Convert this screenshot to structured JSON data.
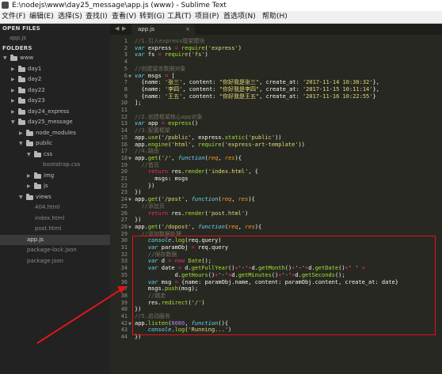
{
  "window": {
    "title": "E:\\nodejs\\www\\day25_message\\app.js (www) - Sublime Text"
  },
  "menu": [
    "文件(F)",
    "编辑(E)",
    "选择(S)",
    "查找(I)",
    "查看(V)",
    "转到(G)",
    "工具(T)",
    "项目(P)",
    "首选项(N)",
    "帮助(H)"
  ],
  "sidebar": {
    "open_files_header": "OPEN FILES",
    "open_files": [
      "app.js"
    ],
    "folders_header": "FOLDERS",
    "tree": [
      {
        "label": "www",
        "type": "folder",
        "depth": 0,
        "expanded": true
      },
      {
        "label": "day1",
        "type": "folder",
        "depth": 1,
        "expanded": false
      },
      {
        "label": "day2",
        "type": "folder",
        "depth": 1,
        "expanded": false
      },
      {
        "label": "day22",
        "type": "folder",
        "depth": 1,
        "expanded": false
      },
      {
        "label": "day23",
        "type": "folder",
        "depth": 1,
        "expanded": false
      },
      {
        "label": "day24_express",
        "type": "folder",
        "depth": 1,
        "expanded": false
      },
      {
        "label": "day25_message",
        "type": "folder",
        "depth": 1,
        "expanded": true
      },
      {
        "label": "node_modules",
        "type": "folder",
        "depth": 2,
        "expanded": false
      },
      {
        "label": "public",
        "type": "folder",
        "depth": 2,
        "expanded": true
      },
      {
        "label": "css",
        "type": "folder",
        "depth": 3,
        "expanded": true
      },
      {
        "label": "bootstrap.css",
        "type": "file",
        "depth": 4
      },
      {
        "label": "img",
        "type": "folder",
        "depth": 3,
        "expanded": false
      },
      {
        "label": "js",
        "type": "folder",
        "depth": 3,
        "expanded": false
      },
      {
        "label": "views",
        "type": "folder",
        "depth": 2,
        "expanded": true
      },
      {
        "label": "404.html",
        "type": "file",
        "depth": 3
      },
      {
        "label": "index.html",
        "type": "file",
        "depth": 3
      },
      {
        "label": "post.html",
        "type": "file",
        "depth": 3
      },
      {
        "label": "app.js",
        "type": "file",
        "depth": 2,
        "selected": true
      },
      {
        "label": "package-lock.json",
        "type": "file",
        "depth": 2
      },
      {
        "label": "package.json",
        "type": "file",
        "depth": 2
      }
    ]
  },
  "editor": {
    "tab_label": "app.js",
    "tab_close": "×",
    "nav_left": "◀",
    "nav_right": "▶",
    "lines": [
      [
        [
          "cm",
          "//1.引入express框架模块"
        ]
      ],
      [
        [
          "kw",
          "var"
        ],
        [
          "t",
          " express "
        ],
        [
          "kk",
          "="
        ],
        [
          "t",
          " "
        ],
        [
          "fn",
          "require"
        ],
        [
          "t",
          "("
        ],
        [
          "st",
          "'express'"
        ],
        [
          "t",
          ")"
        ]
      ],
      [
        [
          "kw",
          "var"
        ],
        [
          "t",
          " fs "
        ],
        [
          "kk",
          "="
        ],
        [
          "t",
          " "
        ],
        [
          "fn",
          "require"
        ],
        [
          "t",
          "("
        ],
        [
          "st",
          "'fs'"
        ],
        [
          "t",
          ")"
        ]
      ],
      [
        [
          "t",
          ""
        ]
      ],
      [
        [
          "cm",
          "//创建留言数据对象"
        ]
      ],
      [
        [
          "kw",
          "var"
        ],
        [
          "t",
          " msgs "
        ],
        [
          "kk",
          "="
        ],
        [
          "t",
          " ["
        ]
      ],
      [
        [
          "t",
          "  {name: "
        ],
        [
          "st",
          "'张三'"
        ],
        [
          "t",
          ", content: "
        ],
        [
          "st",
          "\"你好我是张三\""
        ],
        [
          "t",
          ", create_at: "
        ],
        [
          "st",
          "'2017-11-14 10:30:32'"
        ],
        [
          "t",
          "},"
        ]
      ],
      [
        [
          "t",
          "  {name: "
        ],
        [
          "st",
          "'李四'"
        ],
        [
          "t",
          ", content: "
        ],
        [
          "st",
          "\"你好我是李四\""
        ],
        [
          "t",
          ", create_at: "
        ],
        [
          "st",
          "'2017-11-15 10:11:14'"
        ],
        [
          "t",
          "},"
        ]
      ],
      [
        [
          "t",
          "  {name: "
        ],
        [
          "st",
          "'王五'"
        ],
        [
          "t",
          ", content: "
        ],
        [
          "st",
          "\"你好我是王五\""
        ],
        [
          "t",
          ", create_at: "
        ],
        [
          "st",
          "'2017-11-16 10:22:55'"
        ],
        [
          "t",
          "}"
        ]
      ],
      [
        [
          "t",
          "];"
        ]
      ],
      [
        [
          "t",
          ""
        ]
      ],
      [
        [
          "cm",
          "//2.创建框架核心app对象"
        ]
      ],
      [
        [
          "kw",
          "var"
        ],
        [
          "t",
          " app "
        ],
        [
          "kk",
          "="
        ],
        [
          "t",
          " "
        ],
        [
          "fn",
          "express"
        ],
        [
          "t",
          "()"
        ]
      ],
      [
        [
          "cm",
          "//3.配置框架"
        ]
      ],
      [
        [
          "t",
          "app."
        ],
        [
          "fn",
          "use"
        ],
        [
          "t",
          "("
        ],
        [
          "st",
          "'/public'"
        ],
        [
          "t",
          ", express."
        ],
        [
          "fn",
          "static"
        ],
        [
          "t",
          "("
        ],
        [
          "st",
          "'public'"
        ],
        [
          "t",
          "))"
        ]
      ],
      [
        [
          "t",
          "app."
        ],
        [
          "fn",
          "engine"
        ],
        [
          "t",
          "("
        ],
        [
          "st",
          "'html'"
        ],
        [
          "t",
          ", "
        ],
        [
          "fn",
          "require"
        ],
        [
          "t",
          "("
        ],
        [
          "st",
          "'express-art-template'"
        ],
        [
          "t",
          "))"
        ]
      ],
      [
        [
          "cm",
          "//4.路由"
        ]
      ],
      [
        [
          "t",
          "app."
        ],
        [
          "fn",
          "get"
        ],
        [
          "t",
          "("
        ],
        [
          "st",
          "'/'"
        ],
        [
          "t",
          ", "
        ],
        [
          "kw",
          "function"
        ],
        [
          "t",
          "("
        ],
        [
          "pr",
          "req"
        ],
        [
          "t",
          ", "
        ],
        [
          "pr",
          "res"
        ],
        [
          "t",
          "){"
        ]
      ],
      [
        [
          "t",
          "  "
        ],
        [
          "cm",
          "//首页"
        ]
      ],
      [
        [
          "t",
          "    "
        ],
        [
          "kk",
          "return"
        ],
        [
          "t",
          " res."
        ],
        [
          "fn",
          "render"
        ],
        [
          "t",
          "("
        ],
        [
          "st",
          "'index.html'"
        ],
        [
          "t",
          ", {"
        ]
      ],
      [
        [
          "t",
          "      msgs: msgs"
        ]
      ],
      [
        [
          "t",
          "    })"
        ]
      ],
      [
        [
          "t",
          "})"
        ]
      ],
      [
        [
          "t",
          "app."
        ],
        [
          "fn",
          "get"
        ],
        [
          "t",
          "("
        ],
        [
          "st",
          "'/post'"
        ],
        [
          "t",
          ", "
        ],
        [
          "kw",
          "function"
        ],
        [
          "t",
          "("
        ],
        [
          "pr",
          "req"
        ],
        [
          "t",
          ", "
        ],
        [
          "pr",
          "res"
        ],
        [
          "t",
          "){"
        ]
      ],
      [
        [
          "t",
          "  "
        ],
        [
          "cm",
          "//添加页"
        ]
      ],
      [
        [
          "t",
          "    "
        ],
        [
          "kk",
          "return"
        ],
        [
          "t",
          " res."
        ],
        [
          "fn",
          "render"
        ],
        [
          "t",
          "("
        ],
        [
          "st",
          "'post.html'"
        ],
        [
          "t",
          ")"
        ]
      ],
      [
        [
          "t",
          "})"
        ]
      ],
      [
        [
          "t",
          "app."
        ],
        [
          "fn",
          "get"
        ],
        [
          "t",
          "("
        ],
        [
          "st",
          "'/dopost'"
        ],
        [
          "t",
          ", "
        ],
        [
          "kw",
          "function"
        ],
        [
          "t",
          "("
        ],
        [
          "pr",
          "req"
        ],
        [
          "t",
          ", "
        ],
        [
          "pr",
          "res"
        ],
        [
          "t",
          "){"
        ]
      ],
      [
        [
          "t",
          "  "
        ],
        [
          "cm",
          "//添加数据处理"
        ]
      ],
      [
        [
          "t",
          "    "
        ],
        [
          "kw",
          "console"
        ],
        [
          "t",
          "."
        ],
        [
          "fn",
          "log"
        ],
        [
          "t",
          "(req.query)"
        ]
      ],
      [
        [
          "t",
          "    "
        ],
        [
          "kw",
          "var"
        ],
        [
          "t",
          " paramObj "
        ],
        [
          "kk",
          "="
        ],
        [
          "t",
          " req.query"
        ]
      ],
      [
        [
          "t",
          "    "
        ],
        [
          "cm",
          "//保存数据"
        ]
      ],
      [
        [
          "t",
          "    "
        ],
        [
          "kw",
          "var"
        ],
        [
          "t",
          " d "
        ],
        [
          "kk",
          "="
        ],
        [
          "t",
          " "
        ],
        [
          "kk",
          "new"
        ],
        [
          "t",
          " "
        ],
        [
          "fn",
          "Date"
        ],
        [
          "t",
          "();"
        ]
      ],
      [
        [
          "t",
          "    "
        ],
        [
          "kw",
          "var"
        ],
        [
          "t",
          " date "
        ],
        [
          "kk",
          "="
        ],
        [
          "t",
          " d."
        ],
        [
          "fn",
          "getFullYear"
        ],
        [
          "t",
          "()"
        ],
        [
          "kk",
          "+"
        ],
        [
          "st",
          "'-'"
        ],
        [
          "kk",
          "+"
        ],
        [
          "t",
          "d."
        ],
        [
          "fn",
          "getMonth"
        ],
        [
          "t",
          "()"
        ],
        [
          "kk",
          "+"
        ],
        [
          "st",
          "'-'"
        ],
        [
          "kk",
          "+"
        ],
        [
          "t",
          "d."
        ],
        [
          "fn",
          "getDate"
        ],
        [
          "t",
          "()"
        ],
        [
          "kk",
          "+"
        ],
        [
          "st",
          "' '"
        ],
        [
          "t",
          " "
        ],
        [
          "kk",
          "+"
        ]
      ],
      [
        [
          "t",
          "            d."
        ],
        [
          "fn",
          "getHours"
        ],
        [
          "t",
          "()"
        ],
        [
          "kk",
          "+"
        ],
        [
          "st",
          "'-'"
        ],
        [
          "kk",
          "+"
        ],
        [
          "t",
          "d."
        ],
        [
          "fn",
          "getMinutes"
        ],
        [
          "t",
          "()"
        ],
        [
          "kk",
          "+"
        ],
        [
          "st",
          "'-'"
        ],
        [
          "kk",
          "+"
        ],
        [
          "t",
          "d."
        ],
        [
          "fn",
          "getSeconds"
        ],
        [
          "t",
          "();"
        ]
      ],
      [
        [
          "t",
          "    "
        ],
        [
          "kw",
          "var"
        ],
        [
          "t",
          " msg "
        ],
        [
          "kk",
          "="
        ],
        [
          "t",
          " {name: paramObj.name, content: paramObj.content, create_at: date}"
        ]
      ],
      [
        [
          "t",
          "    msgs."
        ],
        [
          "fn",
          "push"
        ],
        [
          "t",
          "(msg);"
        ]
      ],
      [
        [
          "t",
          "    "
        ],
        [
          "cm",
          "//跳走"
        ]
      ],
      [
        [
          "t",
          "    res."
        ],
        [
          "fn",
          "redirect"
        ],
        [
          "t",
          "("
        ],
        [
          "st",
          "'/'"
        ],
        [
          "t",
          ")"
        ]
      ],
      [
        [
          "t",
          "})"
        ]
      ],
      [
        [
          "cm",
          "//5.启动服务"
        ]
      ],
      [
        [
          "t",
          "app."
        ],
        [
          "fn",
          "listen"
        ],
        [
          "t",
          "("
        ],
        [
          "nm",
          "8080"
        ],
        [
          "t",
          ", "
        ],
        [
          "kw",
          "function"
        ],
        [
          "t",
          "(){"
        ]
      ],
      [
        [
          "t",
          "    "
        ],
        [
          "kw",
          "console"
        ],
        [
          "t",
          "."
        ],
        [
          "fn",
          "log"
        ],
        [
          "t",
          "("
        ],
        [
          "st",
          "'Running...'"
        ],
        [
          "t",
          ")"
        ]
      ],
      [
        [
          "t",
          "})"
        ]
      ]
    ]
  },
  "colors": {
    "background": "#272822",
    "sidebar": "#222222",
    "keyword": "#66d9ef",
    "operator": "#f92672",
    "string": "#e6db74",
    "comment": "#75715e",
    "function": "#a6e22e",
    "param": "#fd971f",
    "number": "#ae81ff",
    "highlight_box": "#e0141b"
  },
  "icons": {
    "folder": "folder-icon",
    "arrow_expanded": "▼",
    "arrow_collapsed": "▶"
  }
}
